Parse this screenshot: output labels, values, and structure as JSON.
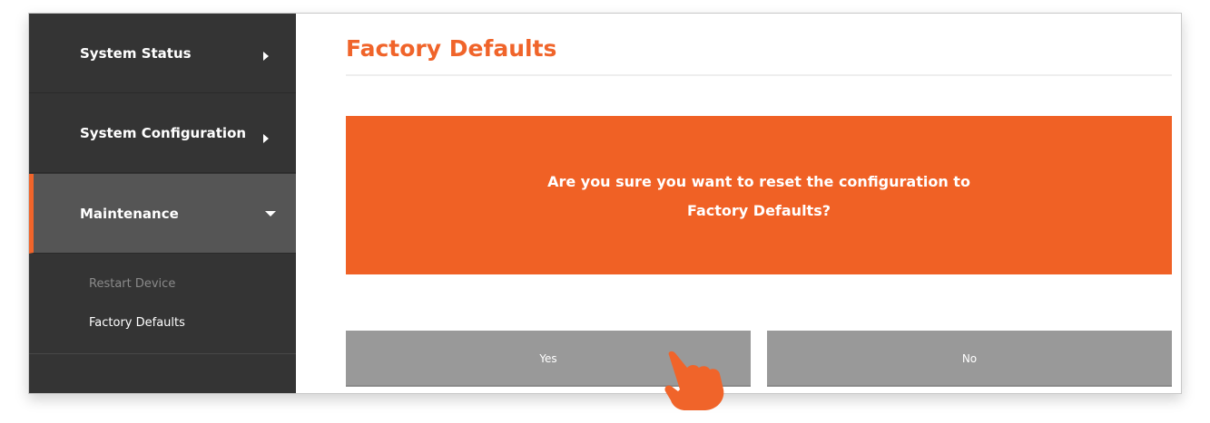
{
  "sidebar": {
    "items": [
      {
        "label": "System Status"
      },
      {
        "label": "System Configuration"
      },
      {
        "label": "Maintenance"
      }
    ],
    "submenu": [
      {
        "label": "Restart Device"
      },
      {
        "label": "Factory Defaults"
      }
    ]
  },
  "main": {
    "title": "Factory Defaults",
    "message_line1": "Are you sure you want to reset the configuration to",
    "message_line2": "Factory Defaults?",
    "yes_label": "Yes",
    "no_label": "No"
  },
  "colors": {
    "accent": "#f0642a",
    "sidebar_bg": "#343434",
    "active_item_bg": "#555555",
    "button_bg": "#999999"
  },
  "icons": {
    "collapsed": "chevron-right-icon",
    "expanded": "chevron-down-icon",
    "pointer": "pointing-hand-icon"
  }
}
